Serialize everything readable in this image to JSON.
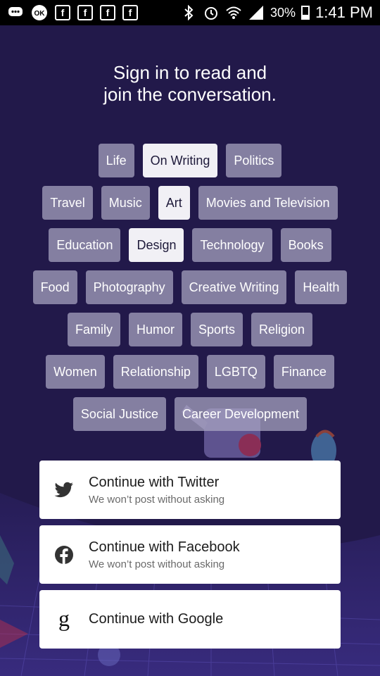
{
  "status_bar": {
    "battery": "30%",
    "time": "1:41 PM"
  },
  "headline": {
    "line1": "Sign in to read and",
    "line2": "join the conversation."
  },
  "topics": [
    [
      {
        "label": "Life",
        "selected": false
      },
      {
        "label": "On Writing",
        "selected": true
      },
      {
        "label": "Politics",
        "selected": false
      }
    ],
    [
      {
        "label": "Travel",
        "selected": false
      },
      {
        "label": "Music",
        "selected": false
      },
      {
        "label": "Art",
        "selected": true
      },
      {
        "label": "Movies and Television",
        "selected": false
      }
    ],
    [
      {
        "label": "Education",
        "selected": false
      },
      {
        "label": "Design",
        "selected": true
      },
      {
        "label": "Technology",
        "selected": false
      },
      {
        "label": "Books",
        "selected": false
      }
    ],
    [
      {
        "label": "Food",
        "selected": false
      },
      {
        "label": "Photography",
        "selected": false
      },
      {
        "label": "Creative Writing",
        "selected": false
      },
      {
        "label": "Health",
        "selected": false
      }
    ],
    [
      {
        "label": "Family",
        "selected": false
      },
      {
        "label": "Humor",
        "selected": false
      },
      {
        "label": "Sports",
        "selected": false
      },
      {
        "label": "Religion",
        "selected": false
      }
    ],
    [
      {
        "label": "Women",
        "selected": false
      },
      {
        "label": "Relationship",
        "selected": false
      },
      {
        "label": "LGBTQ",
        "selected": false
      },
      {
        "label": "Finance",
        "selected": false
      }
    ],
    [
      {
        "label": "Social Justice",
        "selected": false
      },
      {
        "label": "Career Development",
        "selected": false
      }
    ]
  ],
  "auth": {
    "twitter": {
      "title": "Continue with Twitter",
      "subtitle": "We won’t post without asking"
    },
    "facebook": {
      "title": "Continue with Facebook",
      "subtitle": "We won’t post without asking"
    },
    "google": {
      "title": "Continue with Google"
    }
  },
  "colors": {
    "background": "#22194a",
    "chip": "#aaa6c4",
    "chip_selected": "#f1f0f5"
  }
}
